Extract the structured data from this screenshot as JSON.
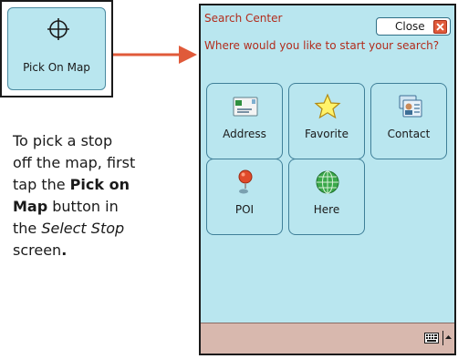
{
  "callout": {
    "icon": "crosshair-icon",
    "label": "Pick On Map"
  },
  "instruction": {
    "line1": "To pick a stop",
    "line2": "off the map, first",
    "line3_prefix": "tap the ",
    "line3_bold": "Pick on",
    "line4_bold": "Map",
    "line4_suffix": " button in",
    "line5_prefix": "the ",
    "line5_italic": "Select Stop",
    "line6": "screen",
    "line6_bold_period": "."
  },
  "screen": {
    "title": "Search Center",
    "close_label": "Close",
    "prompt": "Where would you like to start your search?",
    "tiles": [
      {
        "label": "Address",
        "icon": "envelope-icon"
      },
      {
        "label": "Favorite",
        "icon": "star-icon"
      },
      {
        "label": "Contact",
        "icon": "contact-card-icon"
      },
      {
        "label": "POI",
        "icon": "map-pin-icon"
      },
      {
        "label": "Here",
        "icon": "globe-icon"
      }
    ],
    "bottom_icons": [
      "keyboard-icon",
      "caret-up-icon"
    ]
  },
  "colors": {
    "screen_bg": "#b9e6ef",
    "title_text": "#b22c1c",
    "arrow": "#e05a3a",
    "bottom_bar": "#d8b8ae"
  }
}
